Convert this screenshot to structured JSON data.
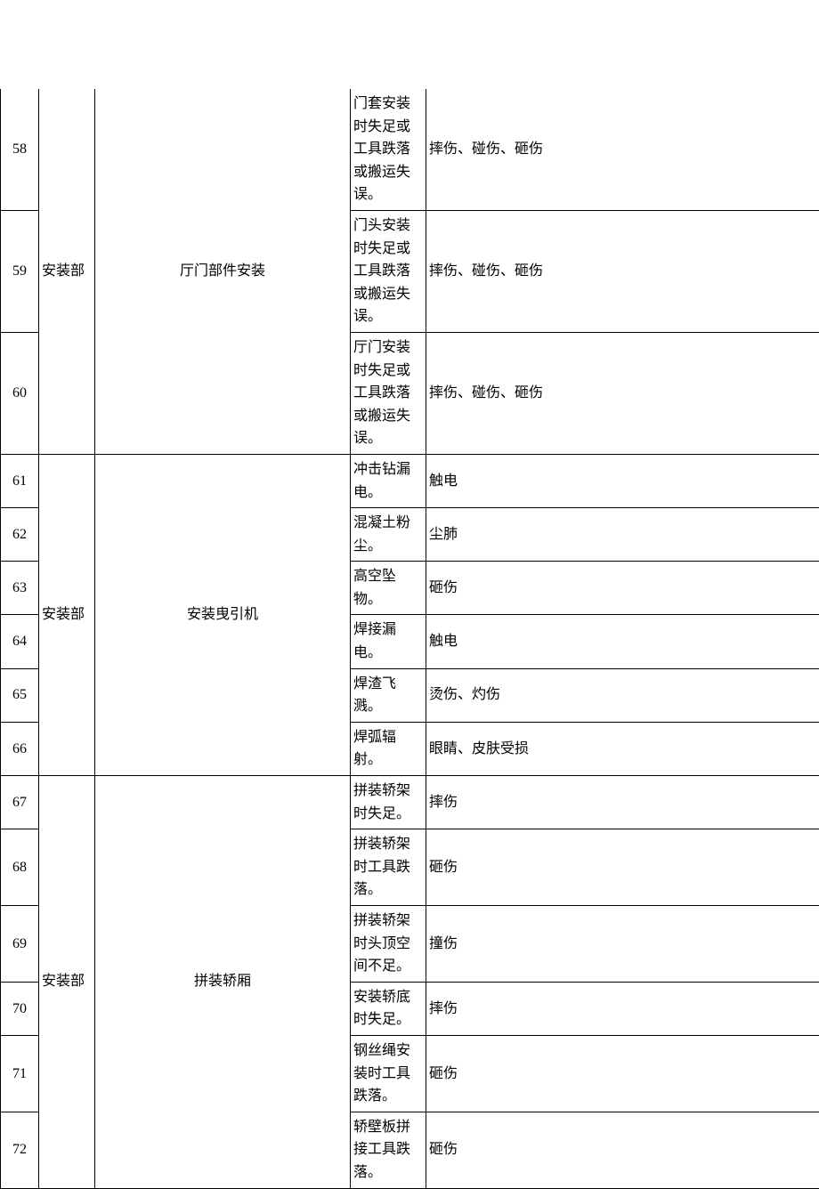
{
  "groups": [
    {
      "dept": "安装部",
      "task": "厅门部件安装",
      "rows": [
        {
          "no": "58",
          "cause": "门套安装时失足或工具跌落或搬运失误。",
          "harm": "摔伤、碰伤、砸伤"
        },
        {
          "no": "59",
          "cause": "门头安装时失足或工具跌落或搬运失误。",
          "harm": "摔伤、碰伤、砸伤"
        },
        {
          "no": "60",
          "cause": "厅门安装时失足或工具跌落或搬运失误。",
          "harm": "摔伤、碰伤、砸伤"
        }
      ]
    },
    {
      "dept": "安装部",
      "task": "安装曳引机",
      "rows": [
        {
          "no": "61",
          "cause": "冲击钻漏电。",
          "harm": "触电"
        },
        {
          "no": "62",
          "cause": "混凝土粉尘。",
          "harm": "尘肺"
        },
        {
          "no": "63",
          "cause": "高空坠物。",
          "harm": "砸伤"
        },
        {
          "no": "64",
          "cause": "焊接漏电。",
          "harm": "触电"
        },
        {
          "no": "65",
          "cause": "焊渣飞溅。",
          "harm": "烫伤、灼伤"
        },
        {
          "no": "66",
          "cause": "焊弧辐射。",
          "harm": "眼睛、皮肤受损"
        }
      ]
    },
    {
      "dept": "安装部",
      "task": "拼装轿厢",
      "rows": [
        {
          "no": "67",
          "cause": "拼装轿架时失足。",
          "harm": "摔伤"
        },
        {
          "no": "68",
          "cause": "拼装轿架时工具跌落。",
          "harm": "砸伤"
        },
        {
          "no": "69",
          "cause": "拼装轿架时头顶空间不足。",
          "harm": "撞伤"
        },
        {
          "no": "70",
          "cause": "安装轿底时失足。",
          "harm": "摔伤"
        },
        {
          "no": "71",
          "cause": "钢丝绳安装时工具跌落。",
          "harm": "砸伤"
        },
        {
          "no": "72",
          "cause": "轿壁板拼接工具跌落。",
          "harm": "砸伤"
        }
      ]
    }
  ]
}
